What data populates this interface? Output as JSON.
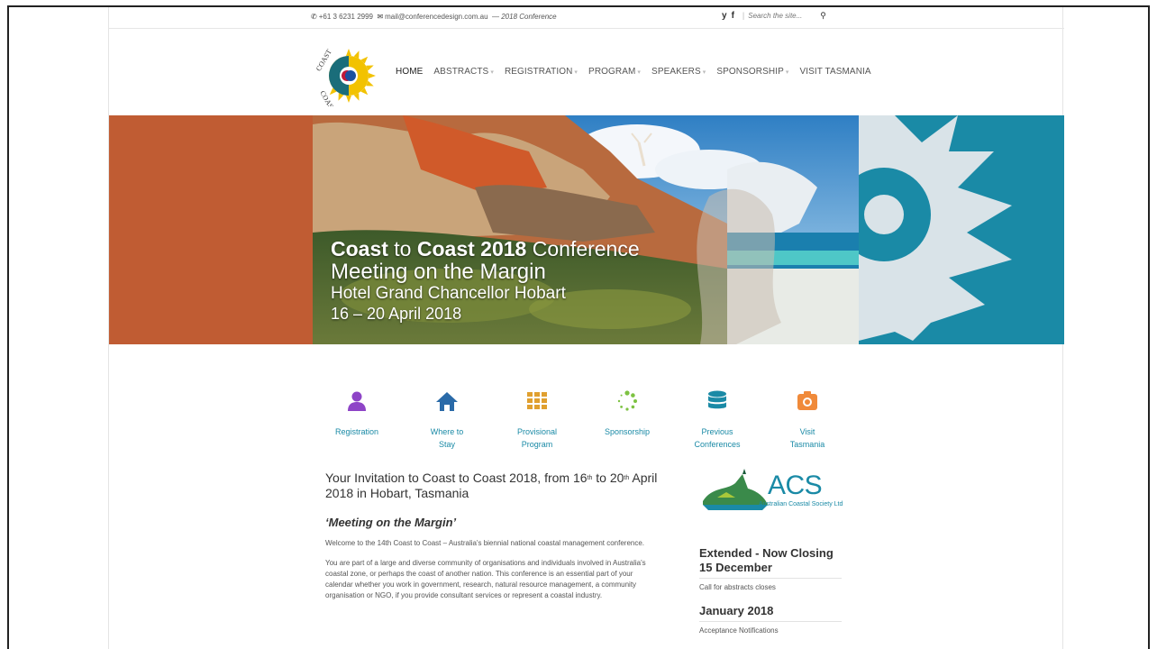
{
  "topbar": {
    "phone": "+61 3 6231 2999",
    "email": "mail@conferencedesign.com.au",
    "dash": "—",
    "conference": "2018 Conference",
    "twitter": "y",
    "facebook": "f",
    "search_placeholder": "Search the site..."
  },
  "nav": {
    "items": [
      {
        "label": "HOME"
      },
      {
        "label": "ABSTRACTS"
      },
      {
        "label": "REGISTRATION"
      },
      {
        "label": "PROGRAM"
      },
      {
        "label": "SPEAKERS"
      },
      {
        "label": "SPONSORSHIP"
      },
      {
        "label": "VISIT TASMANIA"
      }
    ]
  },
  "hero": {
    "line1_a": "Coast",
    "line1_b": " to ",
    "line1_c": "Coast 2018",
    "line1_d": " Conference",
    "line2": "Meeting on the Margin",
    "line3": "Hotel Grand Chancellor Hobart",
    "line4": "16 – 20 April 2018"
  },
  "quicklinks": [
    {
      "label1": "Registration",
      "label2": "",
      "color": "#8e44c7",
      "icon": "user-icon"
    },
    {
      "label1": "Where to",
      "label2": "Stay",
      "color": "#2a6aa8",
      "icon": "home-icon"
    },
    {
      "label1": "Provisional",
      "label2": "Program",
      "color": "#e0a030",
      "icon": "grid-icon"
    },
    {
      "label1": "Sponsorship",
      "label2": "",
      "color": "#7dc242",
      "icon": "spinner-icon"
    },
    {
      "label1": "Previous",
      "label2": "Conferences",
      "color": "#1a8aa6",
      "icon": "database-icon"
    },
    {
      "label1": "Visit",
      "label2": "Tasmania",
      "color": "#f08a3a",
      "icon": "camera-icon"
    }
  ],
  "content": {
    "invite_a": "Your Invitation to Coast to Coast 2018, from 16",
    "invite_sup1": "th",
    "invite_b": " to 20",
    "invite_sup2": "th",
    "invite_c": " April 2018 in Hobart, Tasmania",
    "theme": "‘Meeting on the Margin’",
    "para1": "Welcome to the 14th Coast to Coast – Australia's biennial national coastal management conference.",
    "para2": "You are part of a large and diverse community of organisations and individuals involved in Australia's coastal zone, or perhaps the coast of another nation. This conference is an essential part of your calendar whether you work in government, research, natural resource management, a community organisation or NGO, if you provide consultant services or represent a coastal industry."
  },
  "sidebar": {
    "acs_title": "ACS",
    "acs_subtitle": "Australian Coastal Society Ltd",
    "dates": [
      {
        "head": "Extended - Now Closing 15 December",
        "note": "Call for abstracts closes"
      },
      {
        "head": "January 2018",
        "note": "Acceptance Notifications"
      }
    ]
  },
  "colors": {
    "accent": "#1a8aa6",
    "rust": "#c05c33"
  }
}
